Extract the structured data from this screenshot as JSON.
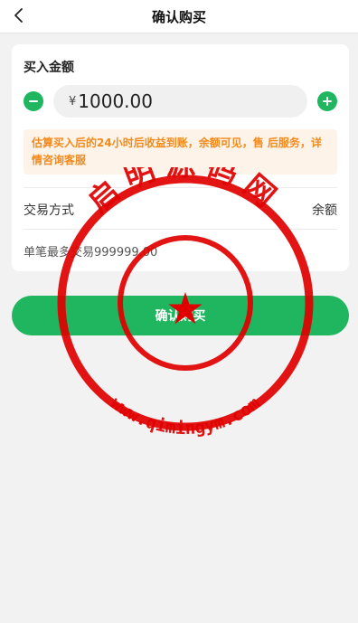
{
  "header": {
    "title": "确认购买",
    "back_icon": "chevron-left-icon"
  },
  "purchase": {
    "section_title": "买入金额",
    "currency_symbol": "¥",
    "amount": "1000.00",
    "notice": "估算买入后的24小时后收益到账，余额可见，售 后服务，详情咨询客服",
    "payment_method_label": "交易方式",
    "payment_method_value": "余额",
    "limit_text": "单笔最多交易999999.00"
  },
  "confirm_button": {
    "label": "确认购买"
  },
  "watermark": {
    "top_text": "启明源码网",
    "bottom_text": "www.qimingym.com"
  },
  "colors": {
    "accent_green": "#1fb65f",
    "notice_orange": "#f28a1c",
    "notice_bg": "#fdf3e8",
    "stamp_red": "#e00000"
  }
}
